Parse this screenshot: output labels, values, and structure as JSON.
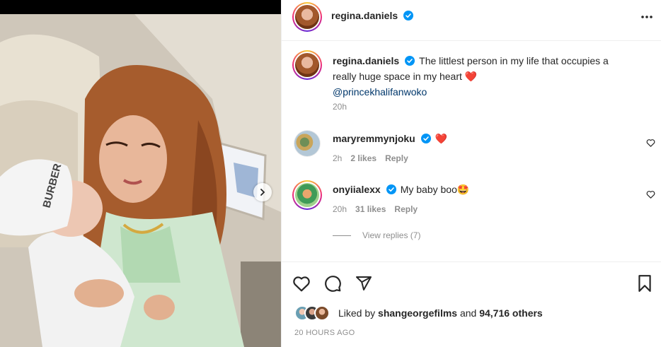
{
  "post": {
    "author": "regina.daniels",
    "cap_text": "BURBER"
  },
  "caption": {
    "username": "regina.daniels",
    "text": "The littlest person in my life that occupies a really huge space in my heart",
    "emoji": "❤️",
    "mention": "@princekhalifanwoko",
    "time": "20h"
  },
  "comments": [
    {
      "username": "maryremmynjoku",
      "text": "",
      "emoji": "❤️",
      "time": "2h",
      "likes": "2 likes",
      "reply": "Reply"
    },
    {
      "username": "onyiialexx",
      "text": "My baby boo",
      "emoji": "🤩",
      "time": "20h",
      "likes": "31 likes",
      "reply": "Reply"
    }
  ],
  "view_replies": "View replies (7)",
  "likes": {
    "prefix": "Liked by",
    "user": "shangeorgefilms",
    "conj": "and",
    "others": "94,716 others"
  },
  "posted_time": "20 HOURS AGO",
  "colors": {
    "verified": "#0095f6",
    "heart": "#ed4956",
    "muted": "#8e8e8e",
    "mention": "#00376b"
  },
  "icons": [
    "heart-icon",
    "comment-icon",
    "share-icon",
    "bookmark-icon",
    "more-icon",
    "verified-icon",
    "chevron-right-icon"
  ]
}
